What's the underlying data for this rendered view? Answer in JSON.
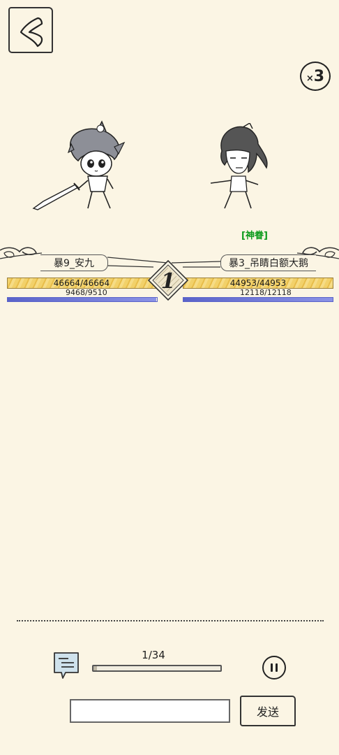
{
  "header": {
    "speed": {
      "prefix": "×",
      "value": "3"
    }
  },
  "battle": {
    "round": "1",
    "left": {
      "name": "暴9_安九",
      "hp_text": "46664/46664",
      "hp_ratio": 1.0,
      "mp_text": "9468/9510",
      "mp_ratio": 0.9956
    },
    "right": {
      "name": "暴3_吊睛白额大鹅",
      "tag": "[神眷]",
      "hp_text": "44953/44953",
      "hp_ratio": 1.0,
      "mp_text": "12118/12118",
      "mp_ratio": 1.0
    }
  },
  "footer": {
    "progress_label": "1/34",
    "progress_ratio": 0.0294,
    "chat_placeholder": "",
    "send_label": "发送"
  },
  "icons": {
    "back": "back-arrow-icon",
    "chat": "chat-log-icon",
    "pause": "pause-icon"
  },
  "colors": {
    "background": "#fbf5e4",
    "hp": "#f2d16a",
    "mp": "#5a63c9",
    "tag": "#0a9a1a"
  }
}
